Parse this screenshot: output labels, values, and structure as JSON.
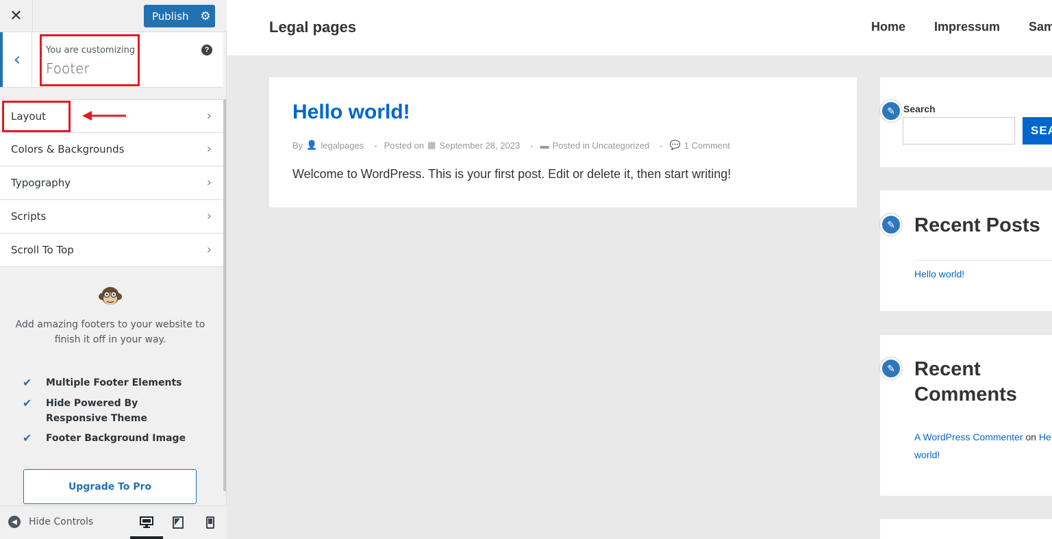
{
  "customizer": {
    "close_icon": "close-icon",
    "publish_label": "Publish",
    "publish_settings_icon": "gear-icon",
    "back_icon": "chevron-left-icon",
    "customizing_label": "You are customizing",
    "section_title": "Footer",
    "help_icon": "question-icon",
    "menu": [
      {
        "label": "Layout"
      },
      {
        "label": "Colors & Backgrounds"
      },
      {
        "label": "Typography"
      },
      {
        "label": "Scripts"
      },
      {
        "label": "Scroll To Top"
      }
    ],
    "promo": {
      "text": "Add amazing footers to your website to finish it off in your way.",
      "features": [
        "Multiple Footer Elements",
        "Hide Powered By Responsive Theme",
        "Footer Background Image"
      ],
      "upgrade_label": "Upgrade To Pro"
    },
    "footer": {
      "hide_controls_label": "Hide Controls",
      "devices": [
        "desktop",
        "tablet",
        "mobile"
      ],
      "active_device": "desktop"
    },
    "annotation_color": "#e11b22",
    "accent_color": "#2271b1"
  },
  "site": {
    "title": "Legal pages",
    "nav": [
      "Home",
      "Impressum",
      "Sam"
    ],
    "post": {
      "title": "Hello world!",
      "meta": {
        "by": "By",
        "author": "legalpages",
        "posted_on": "Posted on",
        "date": "September 28, 2023",
        "posted_in": "Posted in Uncategorized",
        "comments": "1 Comment",
        "separator": "-"
      },
      "excerpt": "Welcome to WordPress. This is your first post. Edit or delete it, then start writing!"
    },
    "widgets": {
      "search": {
        "label": "Search",
        "button": "SEA"
      },
      "recent_posts": {
        "title": "Recent Posts",
        "items": [
          "Hello world!"
        ]
      },
      "recent_comments": {
        "title_line1": "Recent",
        "title_line2": "Comments",
        "author": "A WordPress Commenter",
        "on": "on",
        "post_start": "He",
        "post_end": "world!"
      }
    },
    "link_color": "#0066cc"
  }
}
